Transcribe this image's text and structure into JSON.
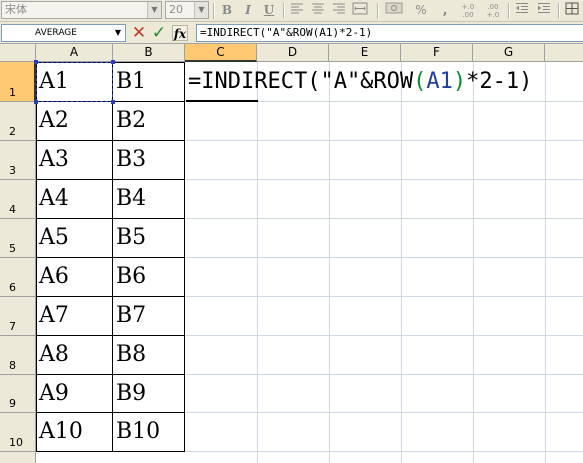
{
  "toolbar": {
    "font_name": "宋体",
    "font_size": "20",
    "bold_label": "B",
    "italic_label": "I",
    "underline_label": "U",
    "percent_label": "%",
    "comma_label": ",",
    "increase_decimal_label": "+.0 .00",
    "decrease_decimal_label": ".00 +.0"
  },
  "formula_bar": {
    "name_box": "AVERAGE",
    "cancel_icon": "✕",
    "enter_icon": "✓",
    "fx_label": "fx",
    "formula": "=INDIRECT(\"A\"&ROW(A1)*2-1)"
  },
  "grid": {
    "columns": [
      "A",
      "B",
      "C",
      "D",
      "E",
      "F",
      "G"
    ],
    "rows": [
      "1",
      "2",
      "3",
      "4",
      "5",
      "6",
      "7",
      "8",
      "9",
      "10"
    ],
    "active_column": "C",
    "active_row": "1",
    "col_a": [
      "A1",
      "A2",
      "A3",
      "A4",
      "A5",
      "A6",
      "A7",
      "A8",
      "A9",
      "A10"
    ],
    "col_b": [
      "B1",
      "B2",
      "B3",
      "B4",
      "B5",
      "B6",
      "B7",
      "B8",
      "B9",
      "B10"
    ]
  },
  "formula_cell": {
    "part1": "=INDIRECT(\"A\"&ROW",
    "open_paren": "(",
    "ref": "A1",
    "close_paren": ")",
    "part2": "*2-1)"
  },
  "colors": {
    "toolbar_bg": "#ece9d8",
    "active_header": "#ffc873",
    "gridline": "#d0d7e5",
    "selection": "#2a3db8",
    "ref_blue": "#1f3fa8",
    "paren_green": "#0a8a2e",
    "cancel_red": "#c0392b",
    "enter_green": "#1e8a2a"
  }
}
